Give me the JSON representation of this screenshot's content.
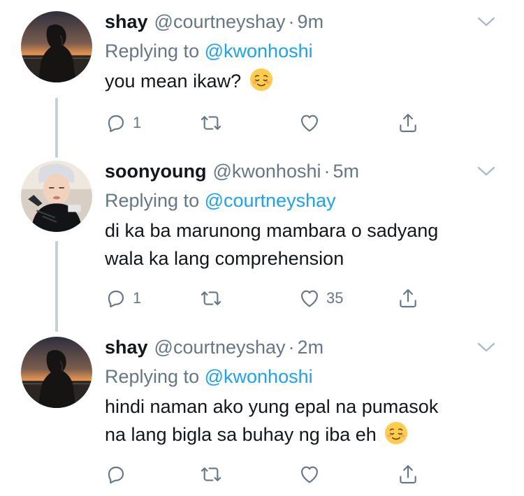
{
  "tweets": [
    {
      "display_name": "shay",
      "handle": "@courtneyshay",
      "separator": "·",
      "time": "9m",
      "replying_prefix": "Replying to",
      "replying_to": "@kwonhoshi",
      "text_lines": [
        "you mean ikaw?"
      ],
      "emoji": "relieved-face",
      "reply_count": "1",
      "retweet_count": "",
      "like_count": "",
      "avatar": "silhouette-sunset"
    },
    {
      "display_name": "soonyoung",
      "handle": "@kwonhoshi",
      "separator": "·",
      "time": "5m",
      "replying_prefix": "Replying to",
      "replying_to": "@courtneyshay",
      "text_lines": [
        "di ka ba marunong mambara o sadyang",
        "wala ka lang comprehension"
      ],
      "emoji": "",
      "reply_count": "1",
      "retweet_count": "",
      "like_count": "35",
      "avatar": "selfie-photo"
    },
    {
      "display_name": "shay",
      "handle": "@courtneyshay",
      "separator": "·",
      "time": "2m",
      "replying_prefix": "Replying to",
      "replying_to": "@kwonhoshi",
      "text_lines": [
        "hindi naman ako yung epal na pumasok",
        "na lang bigla sa buhay ng iba eh"
      ],
      "emoji": "relieved-face",
      "reply_count": "",
      "retweet_count": "",
      "like_count": "",
      "avatar": "silhouette-sunset"
    }
  ],
  "icons": {
    "reply": "reply-icon",
    "retweet": "retweet-icon",
    "like": "heart-icon",
    "share": "share-icon",
    "menu": "chevron-down-icon"
  },
  "colors": {
    "link": "#1da1f2",
    "secondary_text": "#657786",
    "thread_line": "#c4cfd6",
    "primary_text": "#14171a"
  }
}
